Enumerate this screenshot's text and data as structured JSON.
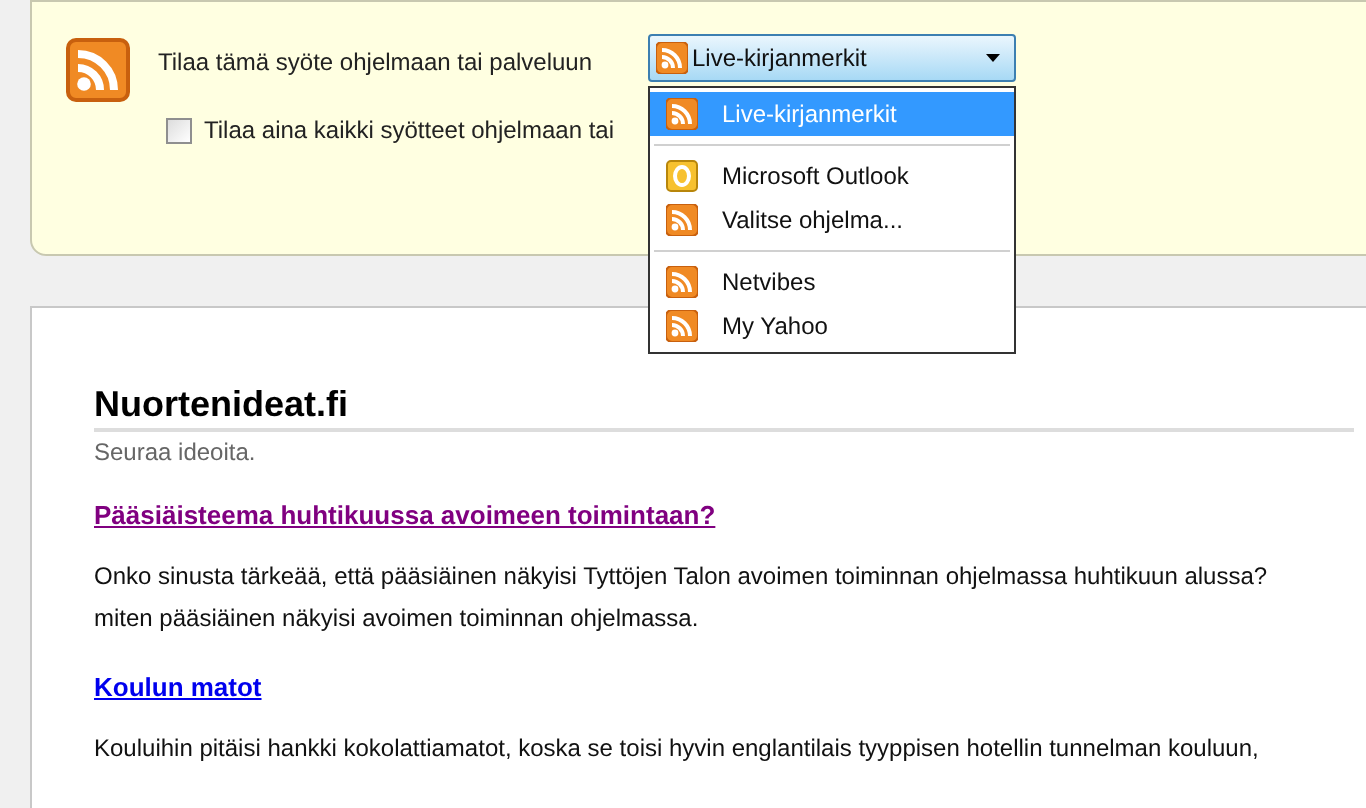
{
  "subscribe_bar": {
    "label": "Tilaa tämä syöte ohjelmaan tai palveluun",
    "dropdown": {
      "value": "Live-kirjanmerkit",
      "expanded": true
    },
    "checkbox": {
      "label": "Tilaa aina kaikki syötteet ohjelmaan tai",
      "checked": false
    }
  },
  "dropdown_menu": {
    "groups": [
      [
        {
          "label": "Live-kirjanmerkit",
          "kind": "rss",
          "selected": true
        }
      ],
      [
        {
          "label": "Microsoft Outlook",
          "kind": "outlook",
          "selected": false
        },
        {
          "label": "Valitse ohjelma...",
          "kind": "rss",
          "selected": false
        }
      ],
      [
        {
          "label": "Netvibes",
          "kind": "rss",
          "selected": false
        },
        {
          "label": "My Yahoo",
          "kind": "rss",
          "selected": false
        }
      ]
    ]
  },
  "feed": {
    "title": "Nuortenideat.fi",
    "subtitle": "Seuraa ideoita.",
    "entries": [
      {
        "title": "Pääsiäisteema huhtikuussa avoimeen toimintaan?",
        "visited": true,
        "lines": [
          "Onko sinusta tärkeää, että pääsiäinen näkyisi Tyttöjen Talon avoimen toiminnan ohjelmassa huhtikuun alussa?",
          "miten pääsiäinen näkyisi avoimen toiminnan ohjelmassa."
        ]
      },
      {
        "title": "Koulun matot",
        "visited": false,
        "lines": [
          "Kouluihin pitäisi hankki kokolattiamatot, koska se toisi hyvin englantilais tyyppisen hotellin tunnelman kouluun,"
        ]
      }
    ]
  }
}
